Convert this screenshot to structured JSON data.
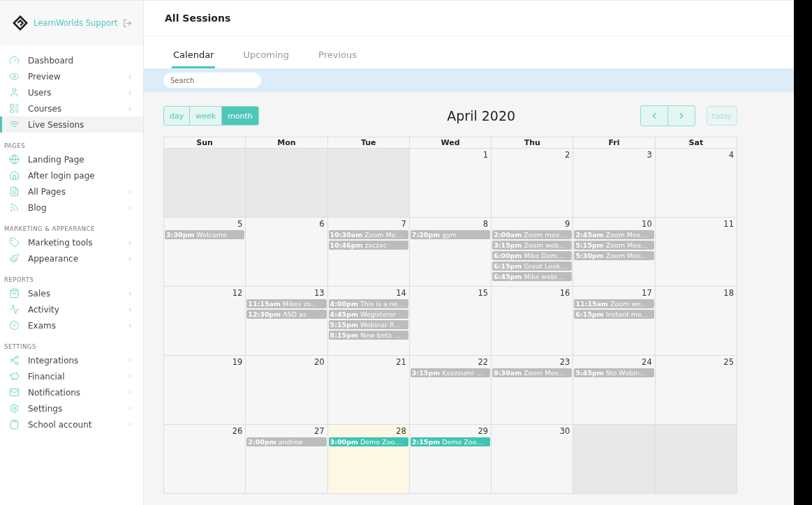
{
  "brand": {
    "name": "LearnWorlds Support"
  },
  "page_title": "All Sessions",
  "sidebar": {
    "sections": [
      {
        "items": [
          {
            "label": "Dashboard",
            "expandable": false,
            "selected": false
          },
          {
            "label": "Preview",
            "expandable": true,
            "selected": false
          },
          {
            "label": "Users",
            "expandable": true,
            "selected": false
          },
          {
            "label": "Courses",
            "expandable": true,
            "selected": false
          },
          {
            "label": "Live Sessions",
            "expandable": false,
            "selected": true
          }
        ]
      },
      {
        "title": "PAGES",
        "items": [
          {
            "label": "Landing Page",
            "expandable": false,
            "selected": false
          },
          {
            "label": "After login page",
            "expandable": false,
            "selected": false
          },
          {
            "label": "All Pages",
            "expandable": true,
            "selected": false
          },
          {
            "label": "Blog",
            "expandable": true,
            "selected": false
          }
        ]
      },
      {
        "title": "MARKETING & APPEARANCE",
        "items": [
          {
            "label": "Marketing tools",
            "expandable": true,
            "selected": false
          },
          {
            "label": "Appearance",
            "expandable": true,
            "selected": false
          }
        ]
      },
      {
        "title": "REPORTS",
        "items": [
          {
            "label": "Sales",
            "expandable": true,
            "selected": false
          },
          {
            "label": "Activity",
            "expandable": true,
            "selected": false
          },
          {
            "label": "Exams",
            "expandable": true,
            "selected": false
          }
        ]
      },
      {
        "title": "SETTINGS",
        "items": [
          {
            "label": "Integrations",
            "expandable": true,
            "selected": false
          },
          {
            "label": "Financial",
            "expandable": true,
            "selected": false
          },
          {
            "label": "Notifications",
            "expandable": true,
            "selected": false
          },
          {
            "label": "Settings",
            "expandable": true,
            "selected": false
          },
          {
            "label": "School account",
            "expandable": true,
            "selected": false
          }
        ]
      }
    ]
  },
  "tabs": [
    {
      "label": "Calendar",
      "selected": true
    },
    {
      "label": "Upcoming",
      "selected": false
    },
    {
      "label": "Previous",
      "selected": false
    }
  ],
  "search": {
    "placeholder": "Search"
  },
  "calendar": {
    "views": [
      {
        "label": "day",
        "selected": false
      },
      {
        "label": "week",
        "selected": false
      },
      {
        "label": "month",
        "selected": true
      }
    ],
    "title": "April 2020",
    "today_button": {
      "label": "today",
      "disabled": true
    },
    "weekdays": [
      "Sun",
      "Mon",
      "Tue",
      "Wed",
      "Thu",
      "Fri",
      "Sat"
    ],
    "weeks": [
      [
        {
          "other_month": true,
          "today": false
        },
        {
          "other_month": true,
          "today": false
        },
        {
          "other_month": true,
          "today": false
        },
        {
          "number": "1",
          "other_month": false,
          "today": false
        },
        {
          "number": "2",
          "other_month": false,
          "today": false
        },
        {
          "number": "3",
          "other_month": false,
          "today": false
        },
        {
          "number": "4",
          "other_month": false,
          "today": false
        }
      ],
      [
        {
          "number": "5",
          "other_month": false,
          "today": false,
          "events": [
            {
              "text": "**3:30pm** Welcome",
              "past": true
            }
          ]
        },
        {
          "number": "6",
          "other_month": false,
          "today": false
        },
        {
          "number": "7",
          "other_month": false,
          "today": false,
          "events": [
            {
              "text": "**10:30am** Zoom Me…",
              "past": true
            },
            {
              "text": "**10:46pm** zxczxc",
              "past": true
            }
          ]
        },
        {
          "number": "8",
          "other_month": false,
          "today": false,
          "events": [
            {
              "text": "**7:20pm** gym",
              "past": true
            }
          ]
        },
        {
          "number": "9",
          "other_month": false,
          "today": false,
          "events": [
            {
              "text": "**2:00am** Zoom mee…",
              "past": true
            },
            {
              "text": "**3:15pm** Zoom web…",
              "past": true
            },
            {
              "text": "**6:00pm** Mike Dem…",
              "past": true
            },
            {
              "text": "**6:15pm** Great Look…",
              "past": true
            },
            {
              "text": "**6:45pm** Mike webi…",
              "past": true
            }
          ]
        },
        {
          "number": "10",
          "other_month": false,
          "today": false,
          "events": [
            {
              "text": "**2:45am** Zoom Mee…",
              "past": true
            },
            {
              "text": "**5:15pm** Zoom Mee…",
              "past": true
            },
            {
              "text": "**5:30pm** Zoom Mee…",
              "past": true
            }
          ]
        },
        {
          "number": "11",
          "other_month": false,
          "today": false
        }
      ],
      [
        {
          "number": "12",
          "other_month": false,
          "today": false
        },
        {
          "number": "13",
          "other_month": false,
          "today": false,
          "events": [
            {
              "text": "**11:15am** Mikes zo…",
              "past": true
            },
            {
              "text": "**12:30pm** ASD as",
              "past": true
            }
          ]
        },
        {
          "number": "14",
          "other_month": false,
          "today": false,
          "events": [
            {
              "text": "**4:00pm** This is a ne…",
              "past": true
            },
            {
              "text": "**4:45pm** Wegisterer",
              "past": true
            },
            {
              "text": "**5:15pm** Webinar R…",
              "past": true
            },
            {
              "text": "**8:15pm** New beta …",
              "past": true
            }
          ]
        },
        {
          "number": "15",
          "other_month": false,
          "today": false
        },
        {
          "number": "16",
          "other_month": false,
          "today": false
        },
        {
          "number": "17",
          "other_month": false,
          "today": false,
          "events": [
            {
              "text": "**11:15am** Zoom we…",
              "past": true
            },
            {
              "text": "**6:15pm** Instant me…",
              "past": true
            }
          ]
        },
        {
          "number": "18",
          "other_month": false,
          "today": false
        }
      ],
      [
        {
          "number": "19",
          "other_month": false,
          "today": false
        },
        {
          "number": "20",
          "other_month": false,
          "today": false
        },
        {
          "number": "21",
          "other_month": false,
          "today": false
        },
        {
          "number": "22",
          "other_month": false,
          "today": false,
          "events": [
            {
              "text": "**3:15pm** Ksezoumi …",
              "past": true
            }
          ]
        },
        {
          "number": "23",
          "other_month": false,
          "today": false,
          "events": [
            {
              "text": "**9:30am** Zoom Mee…",
              "past": true
            }
          ]
        },
        {
          "number": "24",
          "other_month": false,
          "today": false,
          "events": [
            {
              "text": "**5:45pm** Sto Webin…",
              "past": true
            }
          ]
        },
        {
          "number": "25",
          "other_month": false,
          "today": false
        }
      ],
      [
        {
          "number": "26",
          "other_month": false,
          "today": false
        },
        {
          "number": "27",
          "other_month": false,
          "today": false,
          "events": [
            {
              "text": "**2:00pm** andrew",
              "past": true
            }
          ]
        },
        {
          "number": "28",
          "other_month": false,
          "today": true,
          "events": [
            {
              "text": "**3:00pm** Demo Zoo…",
              "past": false
            }
          ]
        },
        {
          "number": "29",
          "other_month": false,
          "today": false,
          "events": [
            {
              "text": "**2:15pm** Demo Zoo…",
              "past": false
            }
          ]
        },
        {
          "number": "30",
          "other_month": false,
          "today": false
        },
        {
          "other_month": true,
          "today": false
        },
        {
          "other_month": true,
          "today": false
        }
      ]
    ]
  }
}
